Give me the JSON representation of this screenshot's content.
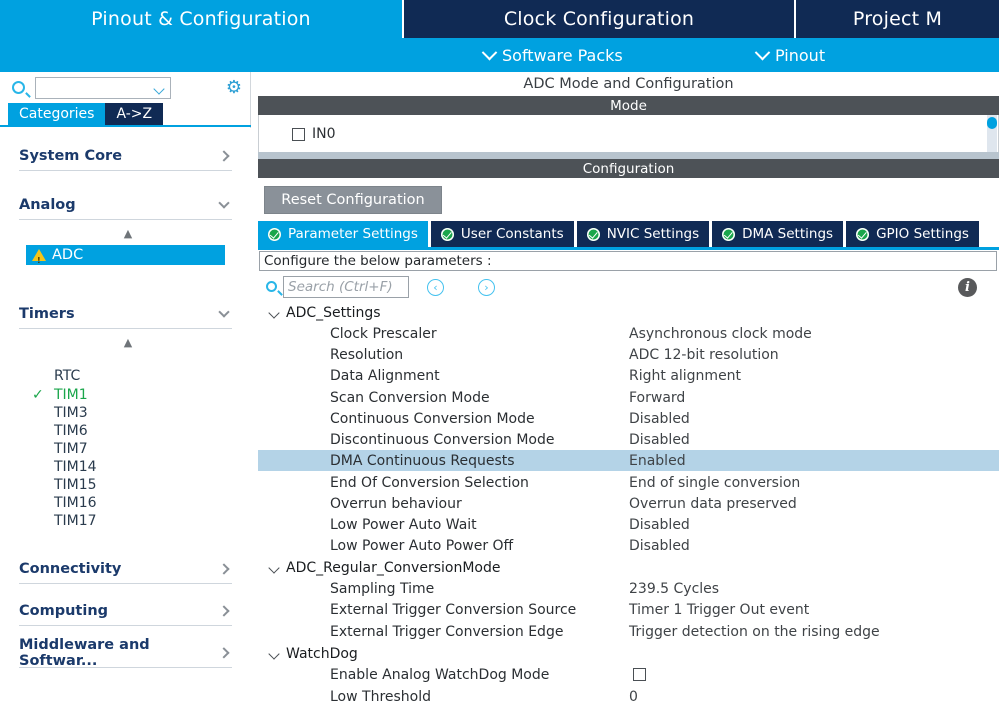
{
  "topbar": {
    "tabs": [
      {
        "label": "Pinout & Configuration",
        "active": true
      },
      {
        "label": "Clock Configuration",
        "active": false
      },
      {
        "label": "Project M",
        "active": false
      }
    ],
    "sub_items": [
      {
        "label": "Software Packs",
        "icon": "chevron-down-icon"
      },
      {
        "label": "Pinout",
        "icon": "chevron-down-icon"
      }
    ],
    "accent_color": "#00a1e0",
    "inactive_color": "#102a54"
  },
  "sidebar": {
    "search": {
      "value": "",
      "placeholder": ""
    },
    "gear_icon": "gear-icon",
    "tabs": [
      {
        "label": "Categories",
        "selected": true
      },
      {
        "label": "A->Z",
        "selected": false
      }
    ],
    "groups": [
      {
        "label": "System Core",
        "expanded": false
      },
      {
        "label": "Analog",
        "expanded": true
      },
      {
        "label": "Timers",
        "expanded": true
      },
      {
        "label": "Connectivity",
        "expanded": false
      },
      {
        "label": "Computing",
        "expanded": false
      },
      {
        "label": "Middleware and Softwar...",
        "expanded": false
      }
    ],
    "analog_items": [
      {
        "label": "ADC",
        "selected": true,
        "status": "warning"
      }
    ],
    "timer_items": [
      {
        "label": "RTC",
        "checked": false
      },
      {
        "label": "TIM1",
        "checked": true
      },
      {
        "label": "TIM3",
        "checked": false
      },
      {
        "label": "TIM6",
        "checked": false
      },
      {
        "label": "TIM7",
        "checked": false
      },
      {
        "label": "TIM14",
        "checked": false
      },
      {
        "label": "TIM15",
        "checked": false
      },
      {
        "label": "TIM16",
        "checked": false
      },
      {
        "label": "TIM17",
        "checked": false
      }
    ]
  },
  "main": {
    "title": "ADC Mode and Configuration",
    "mode_band": "Mode",
    "config_band": "Configuration",
    "mode_channels": [
      {
        "label": "IN0",
        "checked": false
      }
    ],
    "reset_button": "Reset Configuration",
    "tabs": [
      {
        "label": "Parameter Settings",
        "active": true,
        "icon": "check-circle-icon"
      },
      {
        "label": "User Constants",
        "active": false,
        "icon": "check-circle-icon"
      },
      {
        "label": "NVIC Settings",
        "active": false,
        "icon": "check-circle-icon"
      },
      {
        "label": "DMA Settings",
        "active": false,
        "icon": "check-circle-icon"
      },
      {
        "label": "GPIO Settings",
        "active": false,
        "icon": "check-circle-icon"
      }
    ],
    "configure_hint": "Configure the below parameters :",
    "search": {
      "value": "",
      "placeholder": "Search (Ctrl+F)"
    },
    "nav_prev": "‹",
    "nav_next": "›",
    "info_icon": "info-icon",
    "parameters": [
      {
        "kind": "group",
        "label": "ADC_Settings",
        "expanded": true
      },
      {
        "kind": "item",
        "label": "Clock Prescaler",
        "value": "Asynchronous clock mode"
      },
      {
        "kind": "item",
        "label": "Resolution",
        "value": "ADC 12-bit resolution"
      },
      {
        "kind": "item",
        "label": "Data Alignment",
        "value": "Right alignment"
      },
      {
        "kind": "item",
        "label": "Scan Conversion Mode",
        "value": "Forward"
      },
      {
        "kind": "item",
        "label": "Continuous Conversion Mode",
        "value": "Disabled"
      },
      {
        "kind": "item",
        "label": "Discontinuous Conversion Mode",
        "value": "Disabled"
      },
      {
        "kind": "item",
        "label": "DMA Continuous Requests",
        "value": "Enabled",
        "highlighted": true
      },
      {
        "kind": "item",
        "label": "End Of Conversion Selection",
        "value": "End of single conversion"
      },
      {
        "kind": "item",
        "label": "Overrun behaviour",
        "value": "Overrun data preserved"
      },
      {
        "kind": "item",
        "label": "Low Power Auto Wait",
        "value": "Disabled"
      },
      {
        "kind": "item",
        "label": "Low Power Auto Power Off",
        "value": "Disabled"
      },
      {
        "kind": "group",
        "label": "ADC_Regular_ConversionMode",
        "expanded": true
      },
      {
        "kind": "item",
        "label": "Sampling Time",
        "value": "239.5 Cycles"
      },
      {
        "kind": "item",
        "label": "External Trigger Conversion Source",
        "value": "Timer 1 Trigger Out event"
      },
      {
        "kind": "item",
        "label": "External Trigger Conversion Edge",
        "value": "Trigger detection on the rising edge"
      },
      {
        "kind": "group",
        "label": "WatchDog",
        "expanded": true
      },
      {
        "kind": "item",
        "label": "Enable Analog WatchDog Mode",
        "value": "",
        "checkbox": true
      },
      {
        "kind": "item",
        "label": "Low Threshold",
        "value": "0"
      }
    ]
  }
}
